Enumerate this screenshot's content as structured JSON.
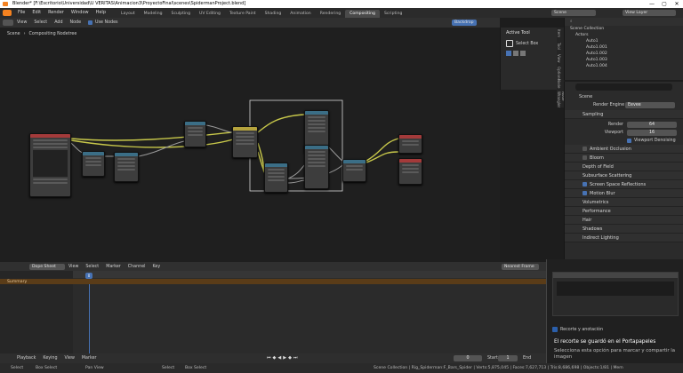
{
  "window": {
    "title": "Blender* [F:\\Escritorio\\Universidad\\U VERITAS\\Animacion3\\ProyectoFinal\\scenes\\SpidermanProject.blend]",
    "controls": [
      "—",
      "▢",
      "✕"
    ]
  },
  "menubar": {
    "items": [
      "File",
      "Edit",
      "Render",
      "Window",
      "Help"
    ],
    "workspaces": [
      "Layout",
      "Modeling",
      "Sculpting",
      "UV Editing",
      "Texture Paint",
      "Shading",
      "Animation",
      "Rendering",
      "Compositing",
      "Scripting"
    ],
    "active_workspace": "Compositing",
    "scene_label": "Scene",
    "view_layer_label": "View Layer"
  },
  "node_editor": {
    "menu": [
      "View",
      "Select",
      "Add",
      "Node"
    ],
    "use_nodes_label": "Use Nodes",
    "backdrop_label": "Backdrop",
    "breadcrumb": [
      "Scene",
      "Compositing Nodetree"
    ]
  },
  "tool_panel": {
    "title": "Active Tool",
    "tool_name": "Select Box"
  },
  "side_tabs": [
    "Item",
    "Tool",
    "View",
    "Options",
    "Node",
    "Node Wrangler"
  ],
  "outliner": {
    "title": "Scene Collection",
    "collection": "Actors",
    "items": [
      "Auto1",
      "Auto1.001",
      "Auto1.002",
      "Auto1.003",
      "Auto1.004"
    ]
  },
  "properties": {
    "search_placeholder": "",
    "scene_name": "Scene",
    "render_engine_label": "Render Engine",
    "render_engine_value": "Eevee",
    "sampling_label": "Sampling",
    "render_label": "Render",
    "render_value": "64",
    "viewport_label": "Viewport",
    "viewport_value": "16",
    "viewport_denoising_label": "Viewport Denoising",
    "panels": [
      {
        "label": "Ambient Occlusion",
        "checkbox": true,
        "checked": false
      },
      {
        "label": "Bloom",
        "checkbox": true,
        "checked": false
      },
      {
        "label": "Depth of Field",
        "checkbox": false,
        "checked": false
      },
      {
        "label": "Subsurface Scattering",
        "checkbox": false,
        "checked": false
      },
      {
        "label": "Screen Space Reflections",
        "checkbox": true,
        "checked": true
      },
      {
        "label": "Motion Blur",
        "checkbox": true,
        "checked": true
      },
      {
        "label": "Volumetrics",
        "checkbox": false,
        "checked": false
      },
      {
        "label": "Performance",
        "checkbox": false,
        "checked": false
      },
      {
        "label": "Hair",
        "checkbox": false,
        "checked": false
      },
      {
        "label": "Shadows",
        "checkbox": false,
        "checked": false
      },
      {
        "label": "Indirect Lighting",
        "checkbox": false,
        "checked": false
      }
    ]
  },
  "dopesheet": {
    "mode": "Dope Sheet",
    "menu": [
      "View",
      "Select",
      "Marker",
      "Channel",
      "Key"
    ],
    "summary_label": "Summary",
    "current_frame": "0",
    "keyframe_filter": "Nearest Frame"
  },
  "playback": {
    "playback_label": "Playback",
    "keying_label": "Keying",
    "view_label": "View",
    "marker_label": "Marker",
    "frame": "0",
    "start_label": "Start",
    "start_value": "1",
    "end_label": "End"
  },
  "statusbar": {
    "left": [
      "Select",
      "Box Select",
      "Pan View"
    ],
    "middle": [
      "Select",
      "Box Select"
    ],
    "stats": "Scene Collection | Rig_Spiderman:F_Bars_Spider | Verts:5,875,045 | Faces:7,627,713 | Tris:8,686,698 | Objects:1/81 | Mem"
  },
  "toast": {
    "app_name": "Recorte y anotación",
    "title": "El recorte se guardó en el Portapapeles",
    "body": "Selecciona esta opción para marcar y compartir la imagen"
  },
  "colors": {
    "accent": "#4772b3",
    "node_link": "#c7c74a",
    "select_frame": "#d8d8d8",
    "summary_bar": "#5a3c18"
  }
}
